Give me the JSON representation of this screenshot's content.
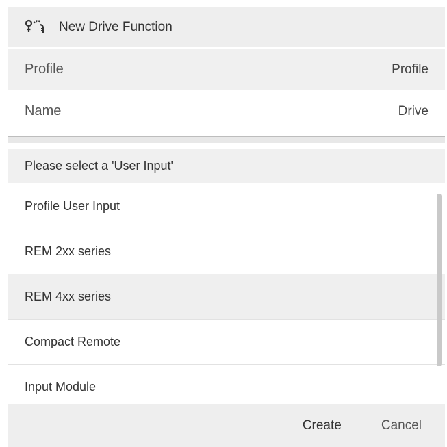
{
  "dialog": {
    "title": "New Drive Function",
    "icon": "drive-function-icon"
  },
  "fields": {
    "profile": {
      "label": "Profile",
      "value": "Profile"
    },
    "name": {
      "label": "Name",
      "value": "Drive"
    }
  },
  "user_input": {
    "prompt": "Please select a 'User Input'",
    "items": [
      {
        "label": "Profile User Input"
      },
      {
        "label": "REM 2xx series"
      },
      {
        "label": "REM 4xx series"
      },
      {
        "label": "Compact Remote"
      },
      {
        "label": "Input Module"
      }
    ],
    "selected": "REM 4xx series"
  },
  "footer": {
    "create_label": "Create",
    "cancel_label": "Cancel"
  }
}
